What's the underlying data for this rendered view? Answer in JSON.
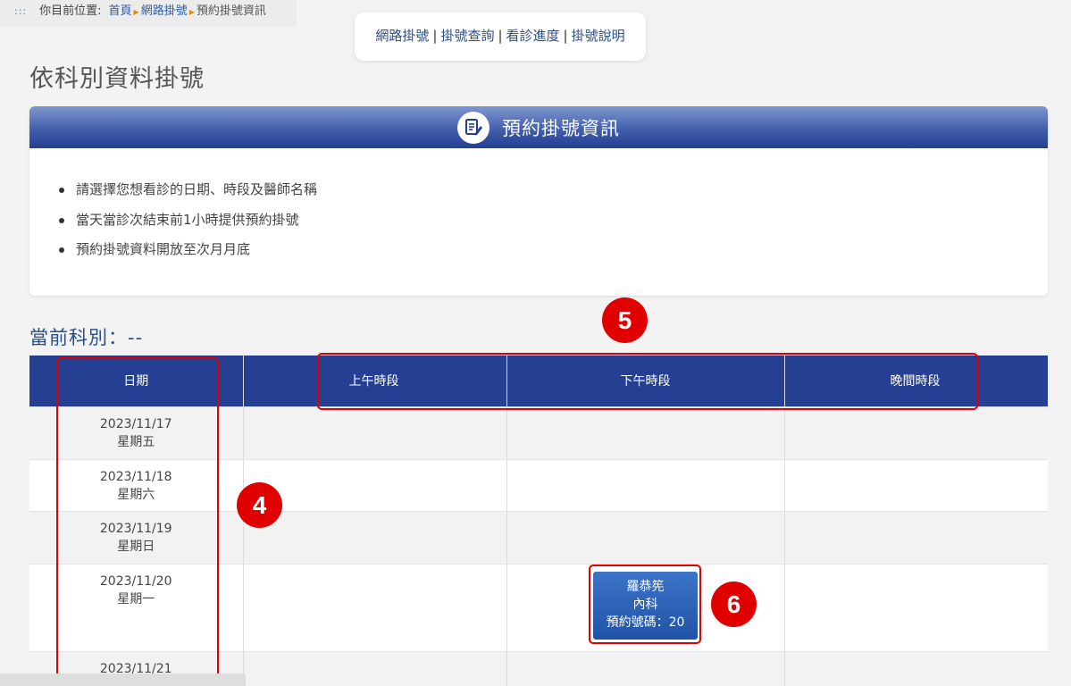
{
  "breadcrumb": {
    "dots": ":::",
    "label": "你目前位置:",
    "items": [
      "首頁",
      "網路掛號"
    ],
    "current": "預約掛號資訊"
  },
  "topnav": {
    "links": [
      "網路掛號",
      "掛號查詢",
      "看診進度",
      "掛號說明"
    ],
    "separator": "|"
  },
  "page_title": "依科別資料掛號",
  "info_panel": {
    "title": "預約掛號資訊",
    "icon": "edit-document-icon",
    "notes": [
      "請選擇您想看診的日期、時段及醫師名稱",
      "當天當診次結束前1小時提供預約掛號",
      "預約掛號資料開放至次月月底"
    ]
  },
  "department": {
    "label": "當前科別：--"
  },
  "schedule": {
    "headers": [
      "日期",
      "上午時段",
      "下午時段",
      "晚間時段"
    ],
    "rows": [
      {
        "date": "2023/11/17",
        "weekday": "星期五"
      },
      {
        "date": "2023/11/18",
        "weekday": "星期六"
      },
      {
        "date": "2023/11/19",
        "weekday": "星期日"
      },
      {
        "date": "2023/11/20",
        "weekday": "星期一"
      },
      {
        "date": "2023/11/21",
        "weekday": ""
      }
    ],
    "appointment": {
      "doctor": "羅恭筅",
      "department": "內科",
      "number_text": "預約號碼：20"
    }
  },
  "annotations": [
    "4",
    "5",
    "6"
  ],
  "colors": {
    "header_blue": "#253f93",
    "annotation_red": "#e00000",
    "appointment_blue": "#2a5db5",
    "link_blue": "#2a4f86"
  }
}
